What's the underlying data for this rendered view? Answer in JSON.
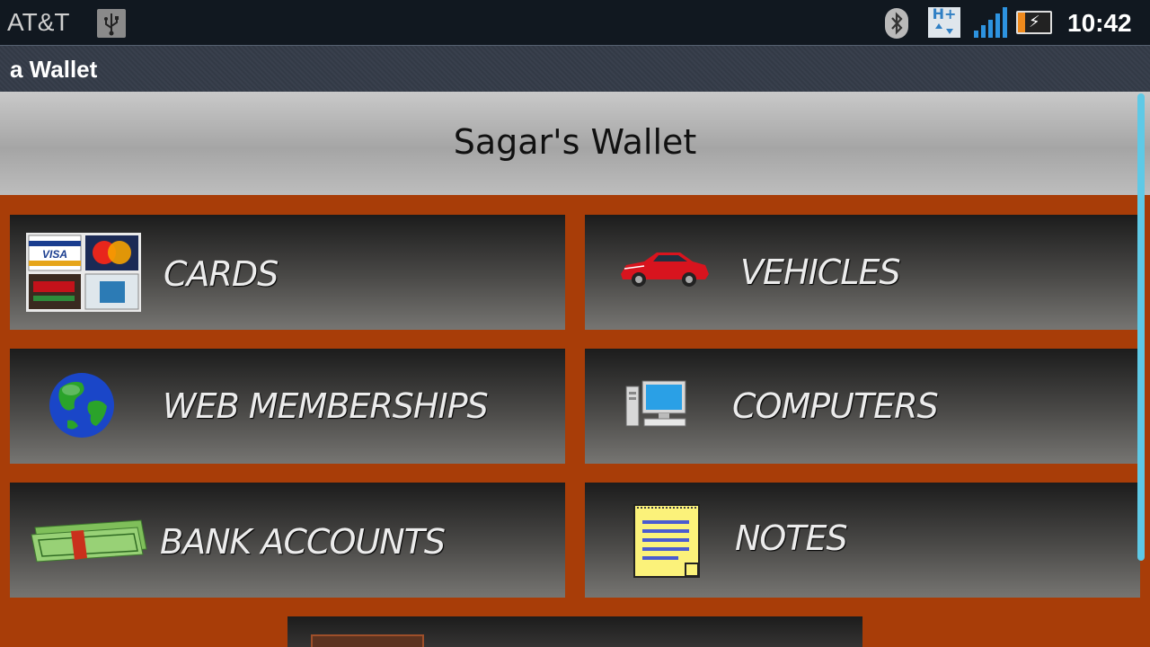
{
  "status_bar": {
    "carrier": "AT&T",
    "time": "10:42",
    "network_badge": "H+",
    "icons": [
      "usb-icon",
      "bluetooth-icon",
      "hplus-network-icon",
      "signal-icon",
      "battery-charging-icon"
    ]
  },
  "app": {
    "title": "a Wallet"
  },
  "header": {
    "title": "Sagar's Wallet"
  },
  "tiles": [
    {
      "label": "CARDS",
      "icon": "credit-cards-icon"
    },
    {
      "label": "VEHICLES",
      "icon": "car-icon"
    },
    {
      "label": "WEB MEMBERSHIPS",
      "icon": "globe-icon"
    },
    {
      "label": "COMPUTERS",
      "icon": "computer-icon"
    },
    {
      "label": "BANK ACCOUNTS",
      "icon": "money-stack-icon"
    },
    {
      "label": "NOTES",
      "icon": "notepad-icon"
    }
  ],
  "colors": {
    "background": "#a83d08",
    "accent_scrollbar": "#5ec9e6"
  }
}
